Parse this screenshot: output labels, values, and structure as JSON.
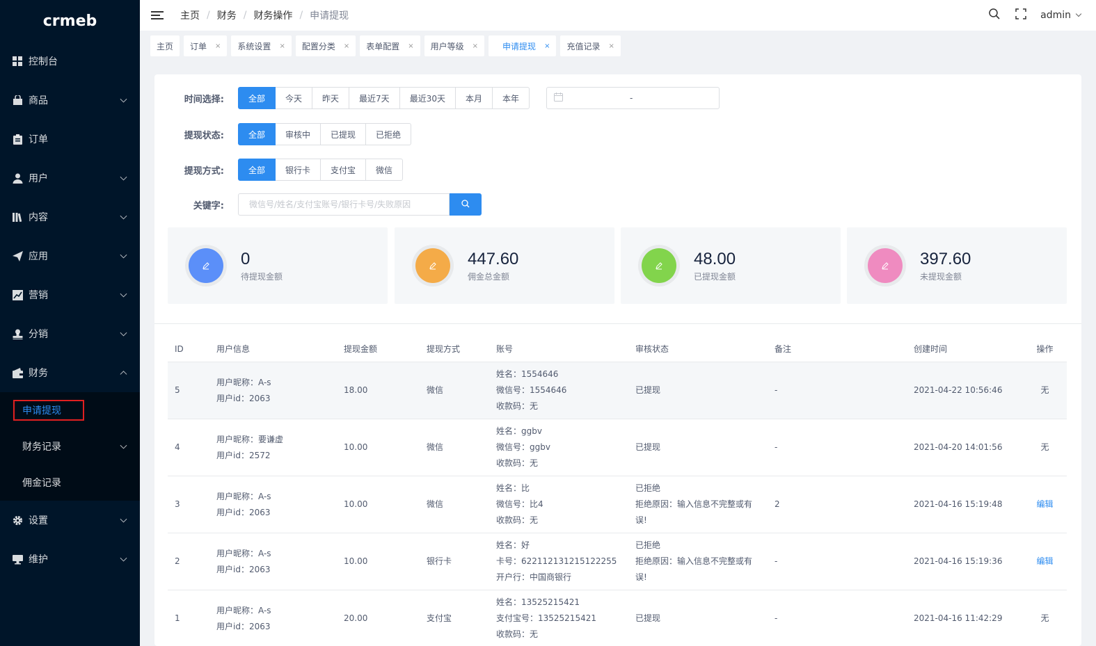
{
  "sidebar": {
    "logo": "crmeb",
    "items": [
      {
        "label": "控制台",
        "icon": "dashboard-icon"
      },
      {
        "label": "商品",
        "icon": "bag-icon"
      },
      {
        "label": "订单",
        "icon": "clipboard-icon"
      },
      {
        "label": "用户",
        "icon": "user-icon"
      },
      {
        "label": "内容",
        "icon": "library-icon"
      },
      {
        "label": "应用",
        "icon": "send-icon"
      },
      {
        "label": "营销",
        "icon": "chart-icon"
      },
      {
        "label": "分销",
        "icon": "stamp-icon"
      },
      {
        "label": "财务",
        "icon": "wallet-icon"
      },
      {
        "label": "设置",
        "icon": "gear-icon"
      },
      {
        "label": "维护",
        "icon": "monitor-icon"
      }
    ],
    "finance_sub": [
      {
        "label": "申请提现"
      },
      {
        "label": "财务记录"
      },
      {
        "label": "佣金记录"
      }
    ]
  },
  "header": {
    "breadcrumb": [
      "主页",
      "财务",
      "财务操作",
      "申请提现"
    ],
    "user": "admin"
  },
  "tabs": [
    {
      "label": "主页"
    },
    {
      "label": "订单",
      "close": "×"
    },
    {
      "label": "系统设置",
      "close": "×"
    },
    {
      "label": "配置分类",
      "close": "×"
    },
    {
      "label": "表单配置",
      "close": "×"
    },
    {
      "label": "用户等级",
      "close": "×"
    },
    {
      "label": "申请提现",
      "close": "×"
    },
    {
      "label": "充值记录",
      "close": "×"
    }
  ],
  "filters": {
    "time": {
      "label": "时间选择:",
      "options": [
        "全部",
        "今天",
        "昨天",
        "最近7天",
        "最近30天",
        "本月",
        "本年"
      ],
      "date_sep": "-"
    },
    "status": {
      "label": "提现状态:",
      "options": [
        "全部",
        "审核中",
        "已提现",
        "已拒绝"
      ]
    },
    "method": {
      "label": "提现方式:",
      "options": [
        "全部",
        "银行卡",
        "支付宝",
        "微信"
      ]
    },
    "keyword": {
      "label": "关键字:",
      "placeholder": "微信号/姓名/支付宝账号/银行卡号/失败原因"
    }
  },
  "stats": [
    {
      "value": "0",
      "label": "待提现金额",
      "color": "#5b8ff9"
    },
    {
      "value": "447.60",
      "label": "佣金总金额",
      "color": "#f4ab48"
    },
    {
      "value": "48.00",
      "label": "已提现金额",
      "color": "#82d44c"
    },
    {
      "value": "397.60",
      "label": "未提现金额",
      "color": "#ef8bc0"
    }
  ],
  "table": {
    "headers": [
      "ID",
      "用户信息",
      "提现金额",
      "提现方式",
      "账号",
      "审核状态",
      "备注",
      "创建时间",
      "操作"
    ],
    "rows": [
      {
        "id": "5",
        "user1": "用户昵称：A-s",
        "user2": "用户id：2063",
        "amount": "18.00",
        "method": "微信",
        "acc1": "姓名：1554646",
        "acc2": "微信号：1554646",
        "acc3": "收款码：无",
        "status1": "已提现",
        "status2": "",
        "note": "-",
        "time": "2021-04-22 10:56:46",
        "op": "无"
      },
      {
        "id": "4",
        "user1": "用户昵称：要谦虚",
        "user2": "用户id：2572",
        "amount": "10.00",
        "method": "微信",
        "acc1": "姓名：ggbv",
        "acc2": "微信号：ggbv",
        "acc3": "收款码：无",
        "status1": "已提现",
        "status2": "",
        "note": "-",
        "time": "2021-04-20 14:01:56",
        "op": "无"
      },
      {
        "id": "3",
        "user1": "用户昵称：A-s",
        "user2": "用户id：2063",
        "amount": "10.00",
        "method": "微信",
        "acc1": "姓名：比",
        "acc2": "微信号：比4",
        "acc3": "收款码：无",
        "status1": "已拒绝",
        "status2": "拒绝原因：输入信息不完整或有误!",
        "note": "2",
        "time": "2021-04-16 15:19:48",
        "op": "编辑"
      },
      {
        "id": "2",
        "user1": "用户昵称：A-s",
        "user2": "用户id：2063",
        "amount": "10.00",
        "method": "银行卡",
        "acc1": "姓名：好",
        "acc2": "卡号：622112131215122255",
        "acc3": "开户行：中国商银行",
        "status1": "已拒绝",
        "status2": "拒绝原因：输入信息不完整或有误!",
        "note": "-",
        "time": "2021-04-16 15:19:36",
        "op": "编辑"
      },
      {
        "id": "1",
        "user1": "用户昵称：A-s",
        "user2": "用户id：2063",
        "amount": "20.00",
        "method": "支付宝",
        "acc1": "姓名：13525215421",
        "acc2": "支付宝号：13525215421",
        "acc3": "收款码：无",
        "status1": "已提现",
        "status2": "",
        "note": "-",
        "time": "2021-04-16 11:42:29",
        "op": "无"
      }
    ]
  }
}
